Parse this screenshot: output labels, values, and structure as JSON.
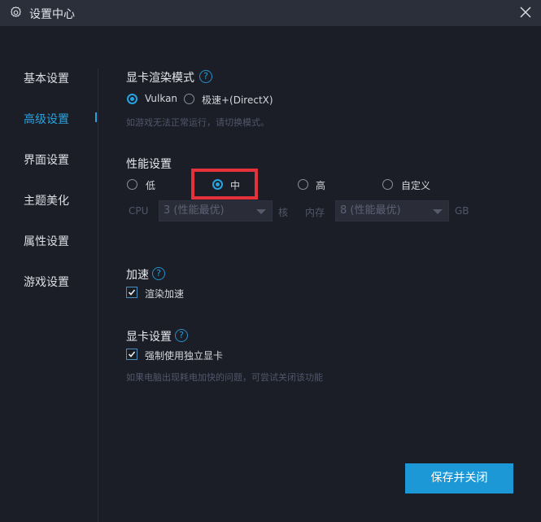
{
  "window": {
    "title": "设置中心",
    "icons": {
      "title": "gear-icon",
      "close": "close-icon"
    }
  },
  "sidebar": {
    "items": [
      {
        "label": "基本设置",
        "active": false
      },
      {
        "label": "高级设置",
        "active": true
      },
      {
        "label": "界面设置",
        "active": false
      },
      {
        "label": "主题美化",
        "active": false
      },
      {
        "label": "属性设置",
        "active": false
      },
      {
        "label": "游戏设置",
        "active": false
      }
    ]
  },
  "render_mode": {
    "title": "显卡渲染模式",
    "help": "?",
    "options": [
      {
        "label": "Vulkan",
        "checked": true
      },
      {
        "label": "极速+(DirectX)",
        "checked": false
      }
    ],
    "hint": "如游戏无法正常运行，请切换模式。"
  },
  "performance": {
    "title": "性能设置",
    "options": [
      {
        "label": "低",
        "checked": false
      },
      {
        "label": "中",
        "checked": true
      },
      {
        "label": "高",
        "checked": false
      },
      {
        "label": "自定义",
        "checked": false
      }
    ],
    "cpu_label": "CPU",
    "cpu_value": "3 (性能最优)",
    "cpu_unit": "核",
    "mem_label": "内存",
    "mem_value": "8 (性能最优)",
    "mem_unit": "GB"
  },
  "acceleration": {
    "title": "加速",
    "help": "?",
    "checkbox_label": "渲染加速",
    "checked": true
  },
  "gpu": {
    "title": "显卡设置",
    "help": "?",
    "checkbox_label": "强制使用独立显卡",
    "checked": true,
    "hint": "如果电脑出现耗电加快的问题，可尝试关闭该功能"
  },
  "footer": {
    "save_label": "保存并关闭"
  },
  "colors": {
    "accent": "#1d98d7",
    "background": "#1c1e27",
    "titlebar": "#2b2f3a",
    "highlight": "#e5313a"
  }
}
